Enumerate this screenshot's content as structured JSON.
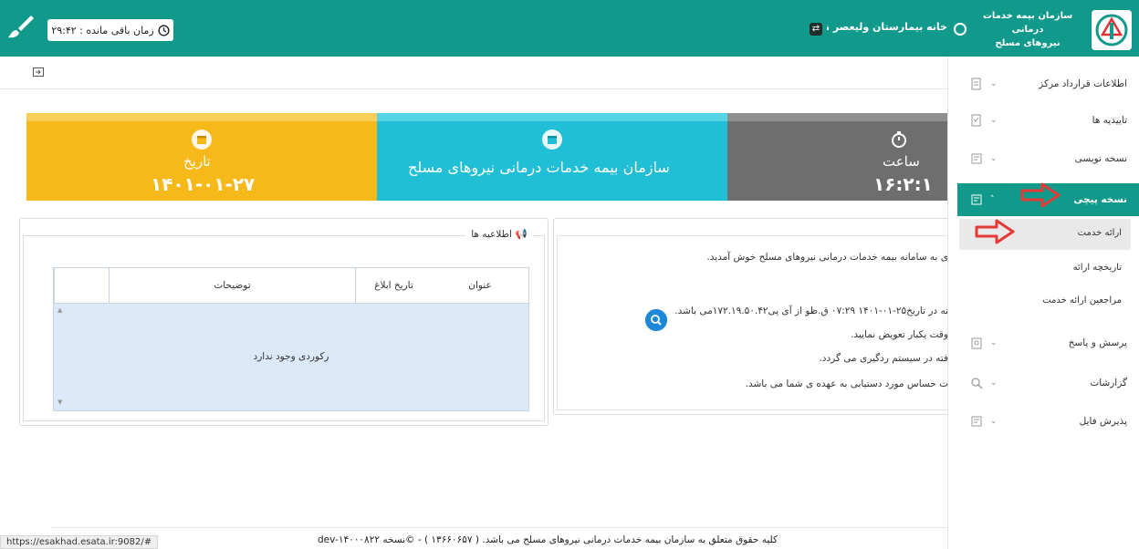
{
  "header": {
    "timer_label": "زمان باقی مانده : ۲۹:۴۲",
    "hospital": "خانه بیمارستان ولیعصر ناجا ۱)",
    "org_line1": "سازمان بیمه خدمات درمانی",
    "org_line2": "نیروهای مسلح"
  },
  "cards": {
    "date_label": "تاریخ",
    "date_value": "۱۴۰۱-۰۱-۲۷",
    "org_name": "سازمان بیمه خدمات درمانی نیروهای مسلح",
    "time_label": "ساعت",
    "time_value": "۱۶:۲:۱"
  },
  "sidebar": {
    "items": [
      {
        "label": "اطلاعات قرارداد مرکز",
        "icon": "document-icon"
      },
      {
        "label": "تاییدیه ها",
        "icon": "checklist-icon"
      },
      {
        "label": "نسخه نویسی",
        "icon": "prescription-icon"
      },
      {
        "label": "نسخه پیچی",
        "icon": "prescription-icon"
      },
      {
        "label": "پرسش و پاسخ",
        "icon": "qa-icon"
      },
      {
        "label": "گزارشات",
        "icon": "report-search-icon"
      },
      {
        "label": "پذیرش فایل",
        "icon": "file-accept-icon"
      }
    ],
    "subitems": [
      {
        "label": "ارائه خدمت"
      },
      {
        "label": "تاریخچه ارائه"
      },
      {
        "label": "مراجعین ارائه خدمت"
      }
    ]
  },
  "announcements": {
    "title": "اطلاعیه ها",
    "columns": [
      "عنوان",
      "تاریخ ابلاغ",
      "توضیحات"
    ],
    "empty_text": "رکوردی وجود ندارد"
  },
  "welcome": {
    "line1": "ی به سامانه بیمه خدمات درمانی نیروهای مسلح خوش آمدید.",
    "line2": "نه در تاریخ۲۵-۰۱-۱۴۰۱ ۰۷:۲۹ ق.ظو از آی پی۱۷۲.۱۹.۵۰.۴۲می باشد.",
    "line3": "وقت یکبار تعویض نمایید.",
    "line4": "فته در سیستم ردگیری می گردد.",
    "line5": "ت حساس مورد دستیابی به عهده ی شما می باشد."
  },
  "footer": {
    "text": "کلیه حقوق متعلق به سازمان بیمه خدمات درمانی نیروهای مسلح می باشد. ( ۱۳۶۶۰۶۵۷ ) - ©نسخه dev-۱۴۰۰۰۸۲۲",
    "status_url": "https://esakhad.esata.ir:9082/#"
  },
  "colors": {
    "primary": "#119a8c",
    "date_card": "#f7b819",
    "org_card": "#21bfd6",
    "time_card": "#6e6e6e",
    "annotation_arrow": "#e53935"
  }
}
